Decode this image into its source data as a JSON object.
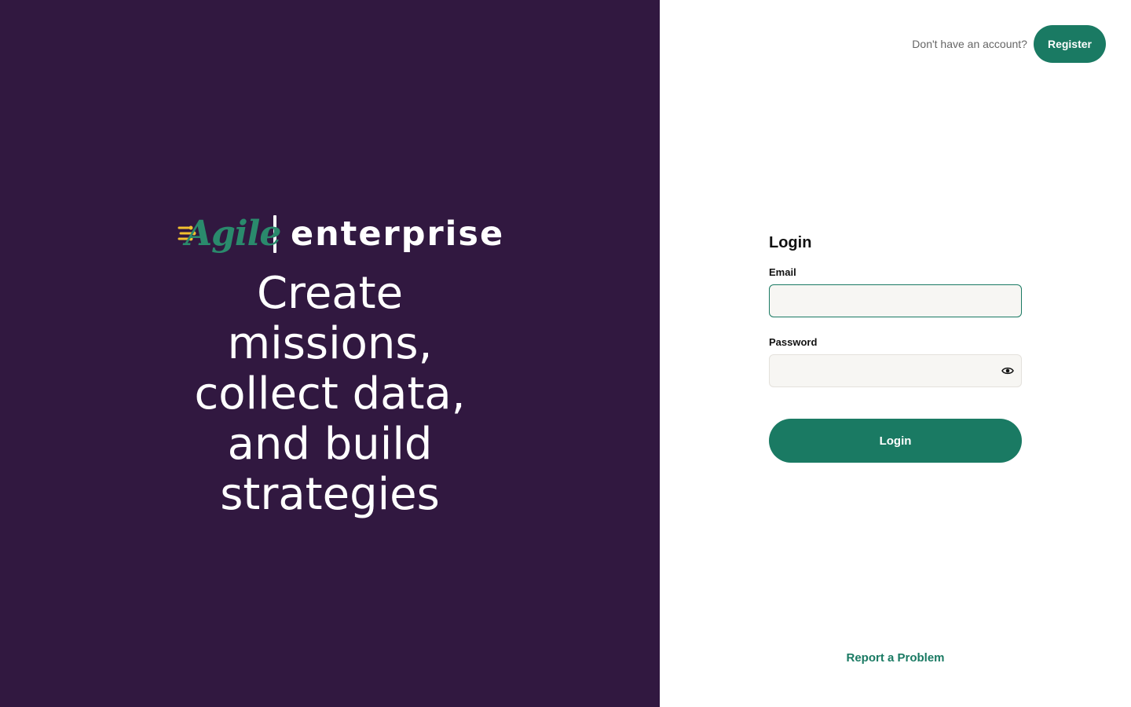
{
  "brand": {
    "logo_text": "Agile",
    "suffix": "enterprise",
    "icon": "spark-icon"
  },
  "hero": {
    "tagline": "Create missions, collect data, and build strategies"
  },
  "header": {
    "account_prompt": "Don't have an account?",
    "register_label": "Register"
  },
  "login_form": {
    "title": "Login",
    "email_label": "Email",
    "email_value": "",
    "password_label": "Password",
    "password_value": "",
    "password_toggle_icon": "eye-icon",
    "submit_label": "Login"
  },
  "footer": {
    "report_label": "Report a Problem"
  },
  "colors": {
    "left_panel_bg": "#311840",
    "accent": "#1a7a63",
    "logo_green": "#2a8a6c",
    "logo_yellow": "#f2c12e"
  }
}
